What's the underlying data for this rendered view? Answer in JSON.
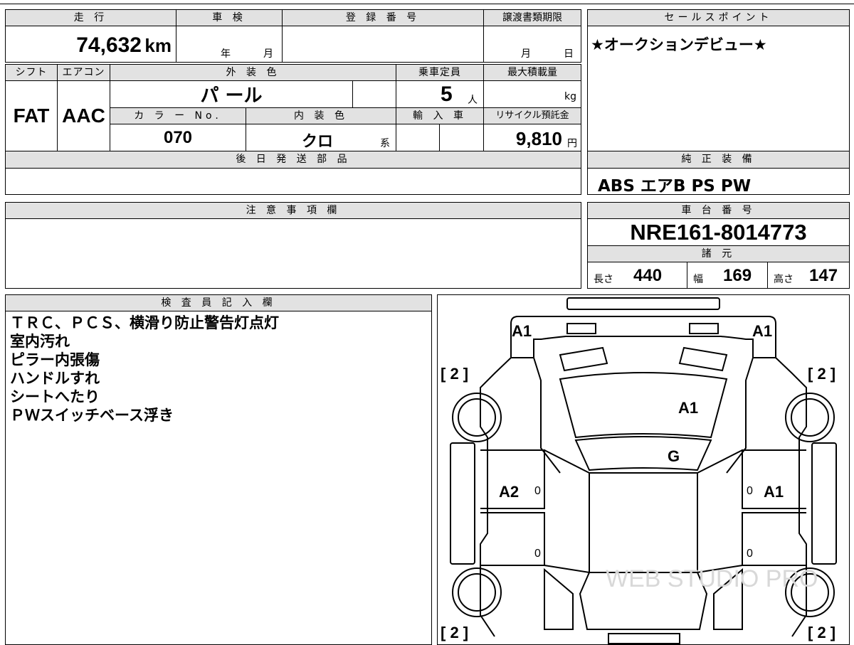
{
  "vehicle": {
    "mileage_label": "走 行",
    "mileage_value": "74,632",
    "mileage_unit": "km",
    "inspection_label": "車 検",
    "inspection_year": "年",
    "inspection_month": "月",
    "registration_label": "登 録 番 号",
    "registration_value": "",
    "transfer_deadline_label": "譲渡書類期限",
    "transfer_month": "月",
    "transfer_day": "日",
    "shift_label": "シフト",
    "shift_value": "FAT",
    "aircon_label": "エアコン",
    "aircon_value": "AAC",
    "exterior_color_label": "外 装 色",
    "exterior_color_value": "パ ール",
    "capacity_label": "乗車定員",
    "capacity_value": "5",
    "capacity_unit": "人",
    "max_load_label": "最大積載量",
    "max_load_value": "",
    "max_load_unit": "kg",
    "color_no_label": "カ ラ ー No.",
    "color_no_value": "070",
    "interior_color_label": "内 装 色",
    "interior_color_value": "クロ",
    "interior_color_suffix": "系",
    "import_label": "輸 入 車",
    "import_value": "",
    "recycle_label": "リサイクル預託金",
    "recycle_value": "9,810",
    "recycle_unit": "円",
    "later_parts_label": "後 日 発 送 部 品",
    "later_parts_value": ""
  },
  "sales_point": {
    "label": "セールスポイント",
    "value": "★オークションデビュー★"
  },
  "equipment": {
    "label": "純 正 装 備",
    "value": "ABS エアB PS PW"
  },
  "caution": {
    "label": "注 意 事 項 欄",
    "value": ""
  },
  "chassis": {
    "label": "車 台 番 号",
    "value": "NRE161-8014773",
    "spec_label": "諸 元",
    "length_label": "長さ",
    "length_value": "440",
    "width_label": "幅",
    "width_value": "169",
    "height_label": "高さ",
    "height_value": "147"
  },
  "inspector": {
    "label": "検 査 員 記 入 欄",
    "notes": [
      "ＴＲＣ、ＰＣＳ、横滑り防止警告灯点灯",
      "室内汚れ",
      "ピラー内張傷",
      "ハンドルすれ",
      "シートへたり",
      "ＰＷスイッチベース浮き"
    ]
  },
  "diagram": {
    "front_left": "A1",
    "front_right": "A1",
    "hood": "A1",
    "windshield": "G",
    "left_front_door": "A2",
    "right_front_door": "A1",
    "tire_front_left": "[ 2 ]",
    "tire_front_right": "[ 2 ]",
    "tire_rear_left": "[ 2 ]",
    "tire_rear_right": "[ 2 ]",
    "door_marks": [
      "0",
      "0",
      "0",
      "0"
    ],
    "watermark": "WEB STUDIO PRO"
  }
}
